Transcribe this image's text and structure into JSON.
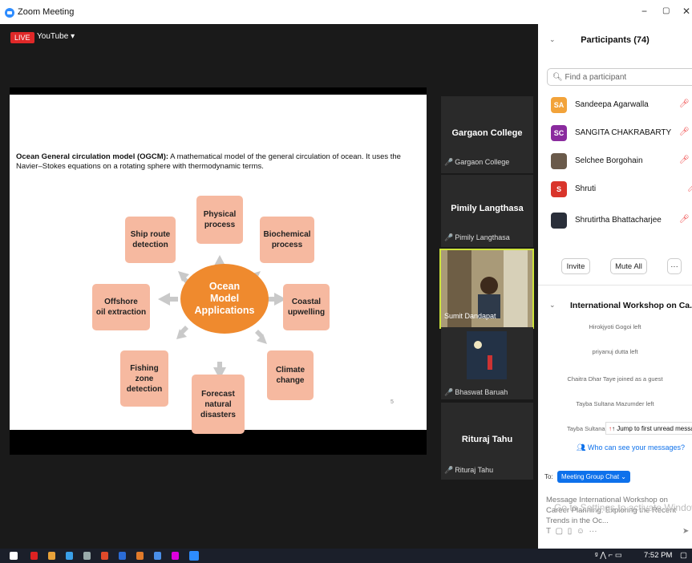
{
  "window": {
    "title": "Zoom Meeting",
    "minimize": "−",
    "restore": "▢",
    "close": "✕"
  },
  "stage": {
    "live_label": "LIVE",
    "youtube_label": "YouTube ▾"
  },
  "slide": {
    "intro_bold": "Ocean General circulation model (OGCM):",
    "intro_text": " A mathematical model of the general circulation of ocean. It uses the Navier–Stokes equations on a rotating sphere with thermodynamic terms.",
    "center": "Ocean\nModel\nApplications",
    "boxes": {
      "physical": "Physical\nprocess",
      "ship": "Ship route\ndetection",
      "biochemical": "Biochemical\nprocess",
      "offshore": "Offshore\noil extraction",
      "coastal": "Coastal\nupwelling",
      "fishing": "Fishing\nzone\ndetection",
      "forecast": "Forecast\nnatural\ndisasters",
      "climate": "Climate\nchange"
    },
    "page_number": "5"
  },
  "video_tiles": [
    {
      "name": "Gargaon College",
      "label": "Gargaon College"
    },
    {
      "name": "Pimily Langthasa",
      "label": "Pimily Langthasa"
    },
    {
      "name": "",
      "label": "Sumit Dandapat"
    },
    {
      "name": "",
      "label": "Bhaswat Baruah"
    },
    {
      "name": "Rituraj Tahu",
      "label": "Rituraj Tahu"
    }
  ],
  "participants": {
    "title": "Participants (74)",
    "search_placeholder": "Find a participant",
    "list": [
      {
        "initials": "SA",
        "name": "Sandeepa Agarwalla",
        "color": "#f2a33a"
      },
      {
        "initials": "SC",
        "name": "SANGITA CHAKRABARTY",
        "color": "#8a2b9e"
      },
      {
        "initials": "",
        "name": "Selchee Borgohain",
        "color": "#6a5a4a"
      },
      {
        "initials": "S",
        "name": "Shruti",
        "color": "#d9352b"
      },
      {
        "initials": "",
        "name": "Shrutirtha Bhattacharjee",
        "color": "#2a2f3a"
      }
    ],
    "invite_label": "Invite",
    "mute_all_label": "Mute All",
    "more_label": "···"
  },
  "chat": {
    "title": "International Workshop on Ca...",
    "messages": [
      "Hirokjyoti Gogoi left",
      "priyanuj dutta left",
      "Chaitra Dhar Taye joined as a guest",
      "Tayba Sultana Mazumder left",
      "Tayba Sultana"
    ],
    "jump_label": "↑ Jump to first unread message",
    "who_label": "Who can see your messages?",
    "to_label": "To:",
    "recipient": "Meeting Group Chat ⌄",
    "compose_placeholder": "Message International Workshop on Career Planning: Exploring the Recent Trends in the Oc...",
    "watermark": "Go to Settings to activate Windows."
  },
  "taskbar": {
    "time": "7:52 PM"
  }
}
